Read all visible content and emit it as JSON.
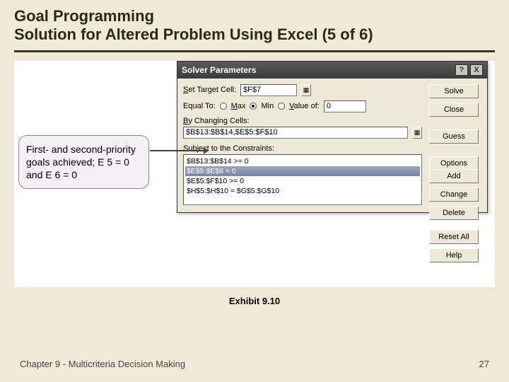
{
  "title_line1": "Goal Programming",
  "title_line2": "Solution for Altered Problem Using Excel (5 of 6)",
  "callout": {
    "text": "First- and second-priority goals achieved; E 5 = 0 and E 6 = 0"
  },
  "solver": {
    "title": "Solver Parameters",
    "help_glyph": "?",
    "close_glyph": "X",
    "labels": {
      "set_target": "Set Target Cell:",
      "equal_to": "Equal To:",
      "max": "Max",
      "min": "Min",
      "value_of": "Value of:",
      "by_changing": "By Changing Cells:",
      "subject_to": "Subject to the Constraints:"
    },
    "fields": {
      "target_cell": "$F$7",
      "value_of": "0",
      "changing_cells": "$B$13:$B$14,$E$5:$F$10"
    },
    "radio_selected": "min",
    "constraints": [
      "$B$13:$B$14 >= 0",
      "$E$5:$E$6 = 0",
      "$E$5:$F$10 >= 0",
      "$H$5:$H$10 = $G$5:$G$10"
    ],
    "constraint_selected_index": 1,
    "buttons": {
      "solve": "Solve",
      "close": "Close",
      "guess": "Guess",
      "options": "Options",
      "add": "Add",
      "change": "Change",
      "delete": "Delete",
      "reset_all": "Reset All",
      "help": "Help"
    }
  },
  "caption": "Exhibit 9.10",
  "footer": {
    "left": "Chapter 9 - Multicriteria Decision Making",
    "right": "27"
  }
}
